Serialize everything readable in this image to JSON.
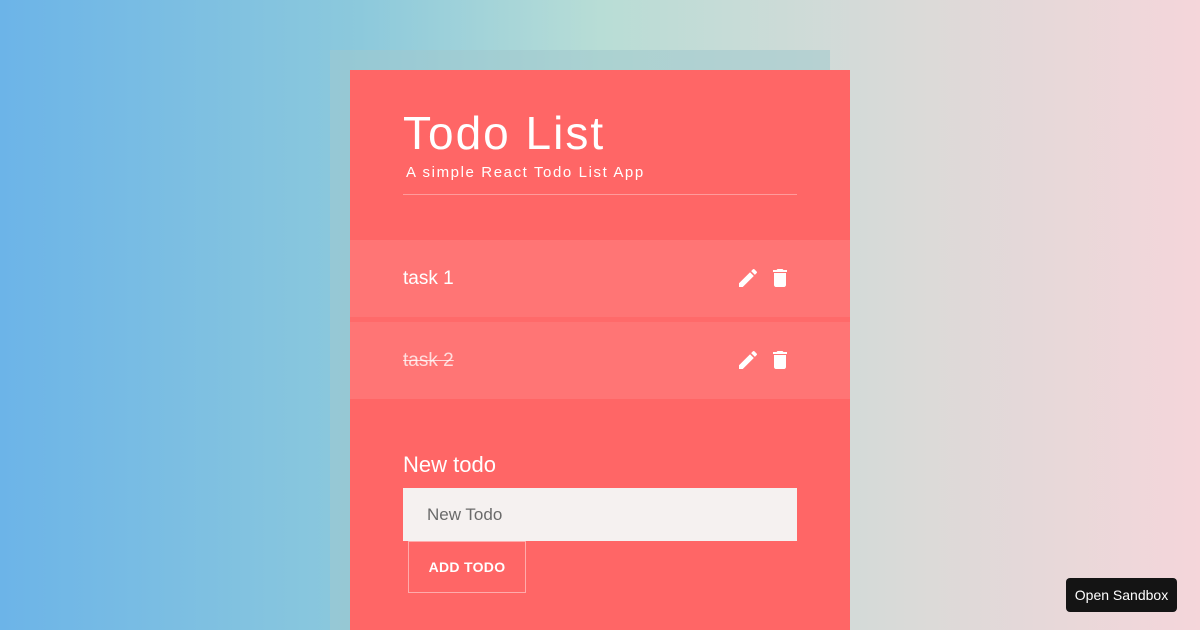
{
  "app": {
    "title": "Todo List",
    "subtitle": "A simple React Todo List App"
  },
  "todos": [
    {
      "label": "task 1",
      "completed": false
    },
    {
      "label": "task 2",
      "completed": true
    }
  ],
  "form": {
    "label": "New todo",
    "input_value": "",
    "placeholder": "New Todo",
    "submit_label": "ADD TODO"
  },
  "sandbox": {
    "label": "Open Sandbox"
  },
  "colors": {
    "card": "#ff6666",
    "row": "#ff7575",
    "input_bg": "#f5f1f0",
    "sandbox_bg": "#141414"
  },
  "icons": {
    "edit": "pencil-icon",
    "delete": "trash-icon"
  }
}
